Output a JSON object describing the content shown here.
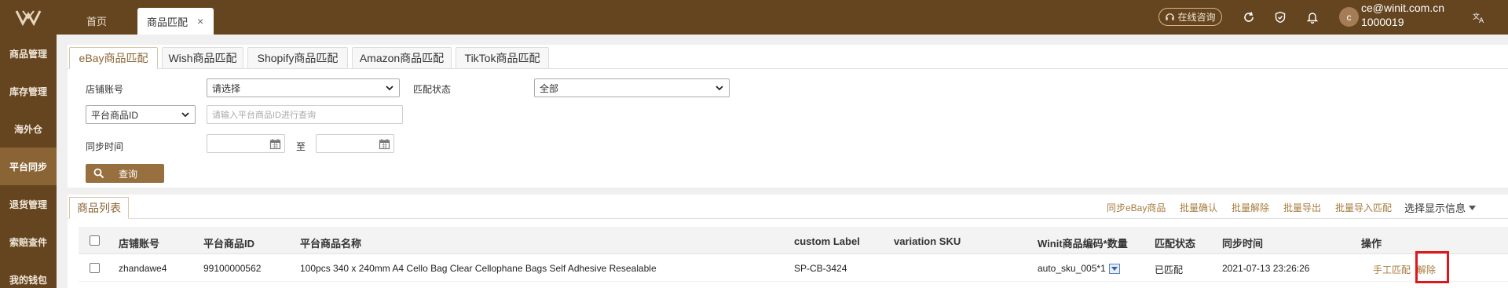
{
  "header": {
    "tabs": {
      "home": "首页",
      "active": "商品匹配",
      "close": "×"
    },
    "online_consult": "在线咨询",
    "user": {
      "avatar": "c",
      "email": "ce@winit.com.cn",
      "id": "1000019"
    }
  },
  "sidebar": {
    "items": [
      {
        "label": "商品管理"
      },
      {
        "label": "库存管理"
      },
      {
        "label": "海外仓"
      },
      {
        "label": "平台同步"
      },
      {
        "label": "退货管理"
      },
      {
        "label": "索赔查件"
      },
      {
        "label": "我的钱包"
      }
    ],
    "active_index": 3
  },
  "filter": {
    "subtabs": [
      "eBay商品匹配",
      "Wish商品匹配",
      "Shopify商品匹配",
      "Amazon商品匹配",
      "TikTok商品匹配"
    ],
    "store_label": "店铺账号",
    "store_value": "请选择",
    "match_status_label": "匹配状态",
    "match_status_value": "全部",
    "id_type_value": "平台商品ID",
    "id_placeholder": "请输入平台商品ID进行查询",
    "sync_time_label": "同步时间",
    "to_label": "至",
    "search_label": "查询"
  },
  "list": {
    "title": "商品列表",
    "actions": [
      "同步eBay商品",
      "批量确认",
      "批量解除",
      "批量导出",
      "批量导入匹配"
    ],
    "display_info": "选择显示信息",
    "columns": {
      "store": "店铺账号",
      "platform_id": "平台商品ID",
      "platform_name": "平台商品名称",
      "custom_label": "custom Label",
      "variation_sku": "variation SKU",
      "winit_sku": "Winit商品编码*数量",
      "match_status": "匹配状态",
      "sync_time": "同步时间",
      "operation": "操作"
    },
    "rows": [
      {
        "store": "zhandawe4",
        "platform_id": "99100000562",
        "platform_name": "100pcs 340 x 240mm A4 Cello Bag Clear Cellophane Bags Self Adhesive Resealable",
        "custom_label": "SP-CB-3424",
        "variation_sku": "",
        "winit_sku": "auto_sku_005*1",
        "match_status": "已匹配",
        "sync_time": "2021-07-13 23:26:26",
        "manual_match": "手工匹配",
        "unbind": "解除"
      }
    ]
  },
  "colors": {
    "brand": "#654520",
    "accent": "#a77b3f",
    "highlight": "#e0171a"
  }
}
